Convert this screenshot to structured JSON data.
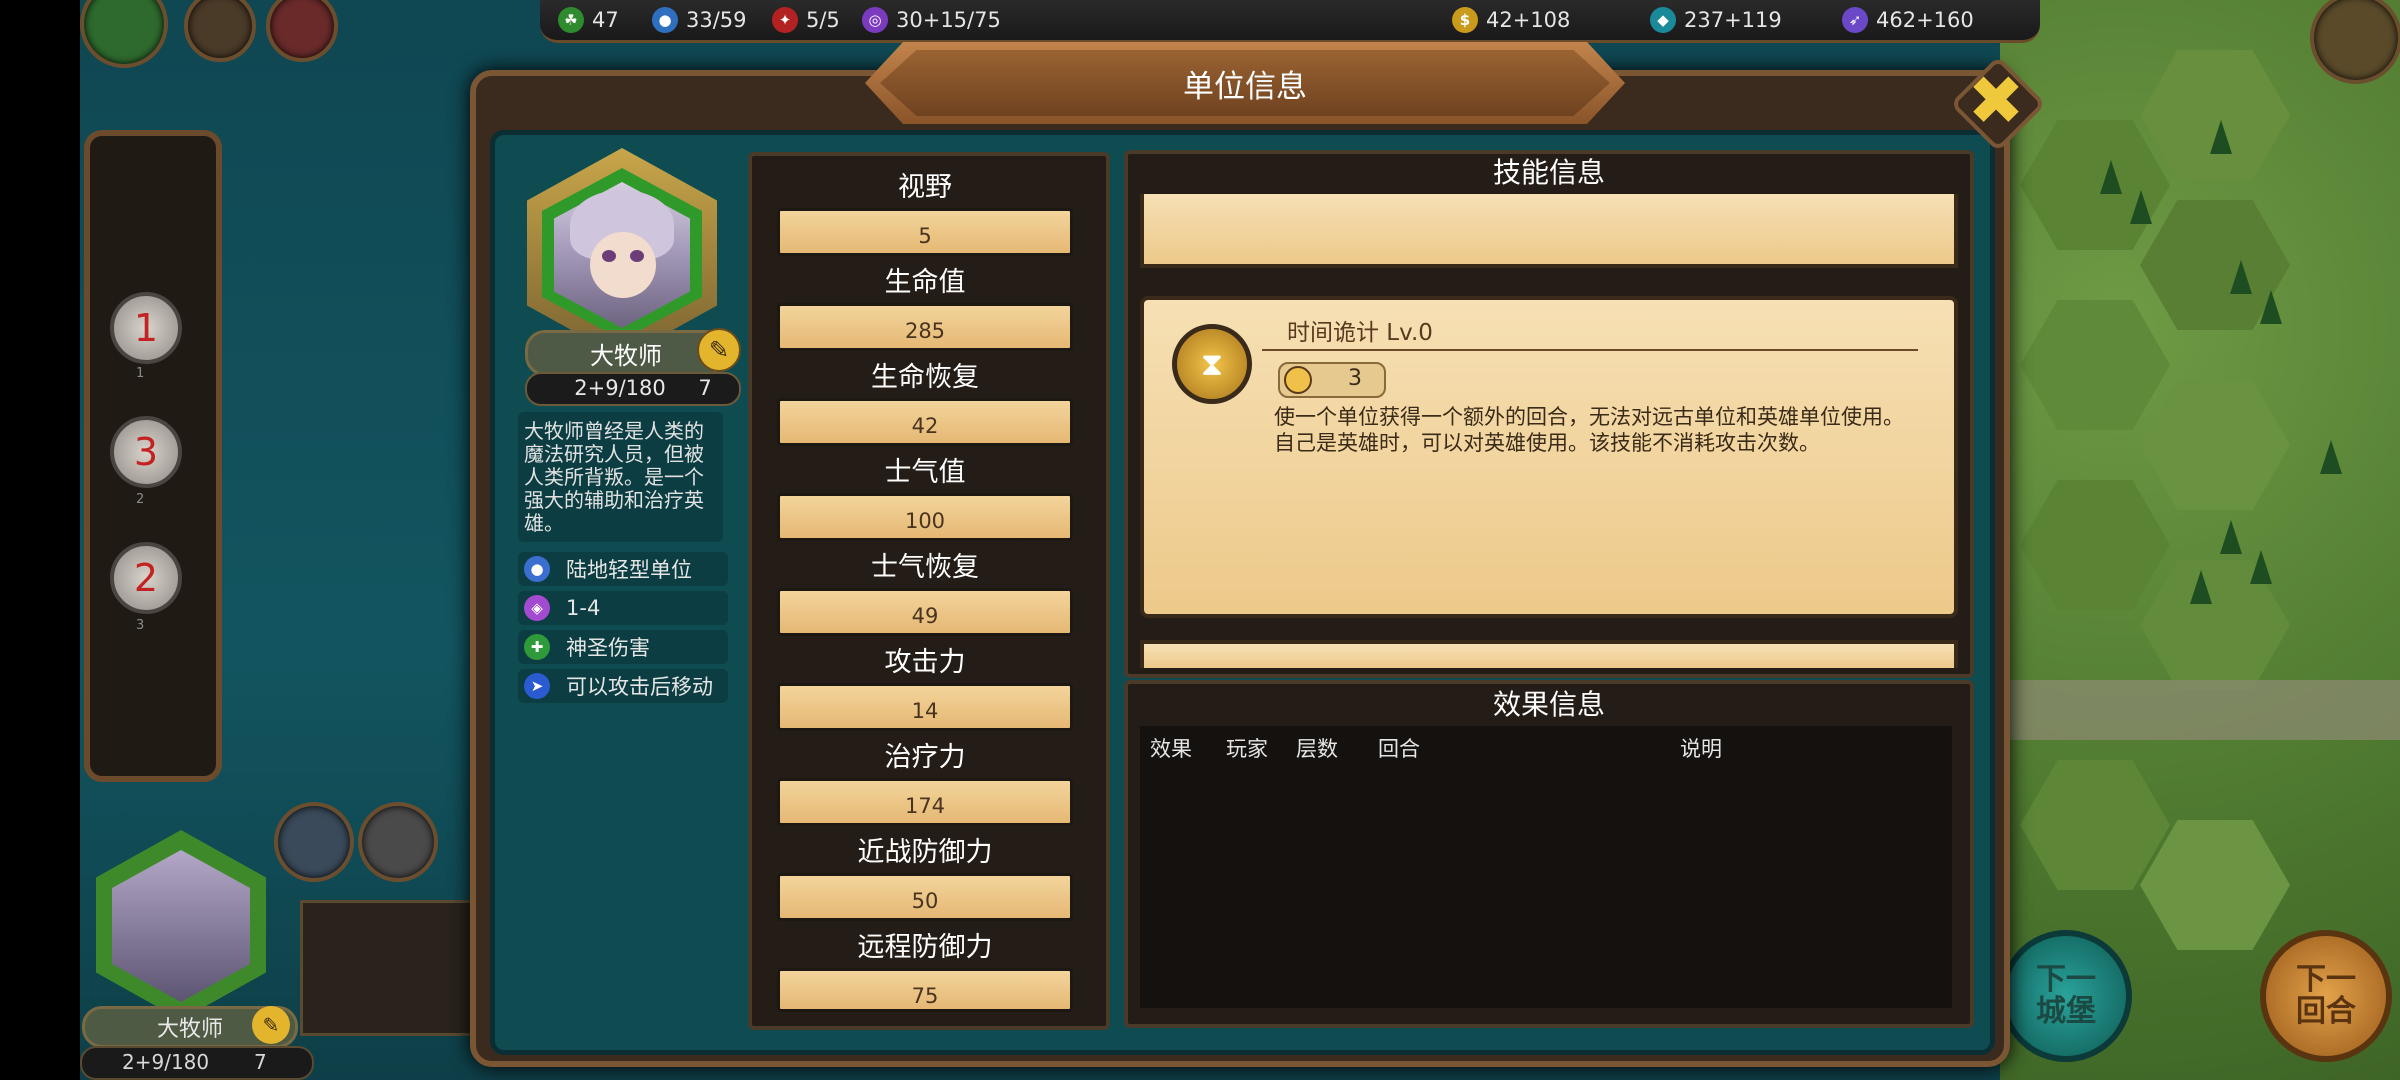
{
  "topbar": {
    "resources": [
      {
        "icon": "green-pop-icon",
        "value": "47",
        "color": "#2e8b2e"
      },
      {
        "icon": "blue-unit-icon",
        "value": "33/59",
        "color": "#2f6fbf"
      },
      {
        "icon": "red-hero-icon",
        "value": "5/5",
        "color": "#b22222"
      },
      {
        "icon": "purple-magic-icon",
        "value": "30+15/75",
        "color": "#7a3bbf"
      },
      {
        "icon": "gold-coin-icon",
        "value": "42+108",
        "color": "#c99a1c"
      },
      {
        "icon": "teal-crystal-icon",
        "value": "237+119",
        "color": "#1a8a9a"
      },
      {
        "icon": "purple-mana-icon",
        "value": "462+160",
        "color": "#6a48c8"
      }
    ]
  },
  "sidebar": {
    "slots": [
      {
        "big": "1",
        "small": "1"
      },
      {
        "big": "3",
        "small": "2"
      },
      {
        "big": "2",
        "small": "3"
      }
    ]
  },
  "bottom_left": {
    "name": "大牧师",
    "exp": "2+9/180",
    "level": "7"
  },
  "bottom_right": {
    "next_castle": "下一\n城堡",
    "next_turn": "下一\n回合"
  },
  "dialog": {
    "title": "单位信息",
    "hero": {
      "name": "大牧师",
      "exp": "2+9/180",
      "level": "7",
      "description": "大牧师曾经是人类的魔法研究人员，但被人类所背叛。是一个强大的辅助和治疗英雄。",
      "traits": [
        {
          "icon": "person-icon",
          "color": "#3a6fd0",
          "label": "陆地轻型单位"
        },
        {
          "icon": "range-icon",
          "color": "#a24ad0",
          "label": "1-4"
        },
        {
          "icon": "holy-icon",
          "color": "#2e9a3a",
          "label": "神圣伤害"
        },
        {
          "icon": "move-icon",
          "color": "#2a5bd0",
          "label": "可以攻击后移动"
        }
      ]
    },
    "stats": [
      {
        "label": "视野",
        "value": "5"
      },
      {
        "label": "生命值",
        "value": "285"
      },
      {
        "label": "生命恢复",
        "value": "42"
      },
      {
        "label": "士气值",
        "value": "100"
      },
      {
        "label": "士气恢复",
        "value": "49"
      },
      {
        "label": "攻击力",
        "value": "14"
      },
      {
        "label": "治疗力",
        "value": "174"
      },
      {
        "label": "近战防御力",
        "value": "50"
      },
      {
        "label": "远程防御力",
        "value": "75"
      }
    ],
    "skills": {
      "title": "技能信息",
      "skill": {
        "name": "时间诡计 Lv.0",
        "cooldown": "3",
        "description": "使一个单位获得一个额外的回合，无法对远古单位和英雄单位使用。自己是英雄时，可以对英雄使用。该技能不消耗攻击次数。"
      }
    },
    "effects": {
      "title": "效果信息",
      "headers": [
        "效果",
        "玩家",
        "层数",
        "回合",
        "说明"
      ]
    }
  }
}
